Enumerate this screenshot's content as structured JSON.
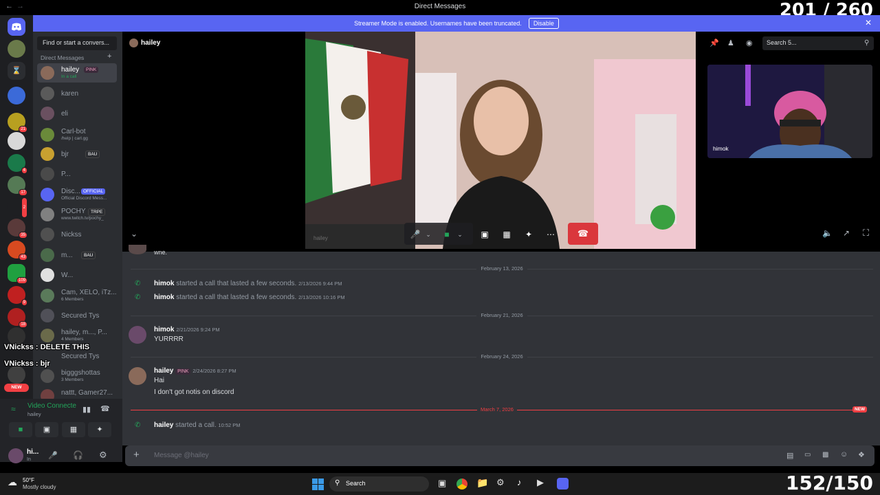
{
  "window": {
    "title": "Direct Messages"
  },
  "overlay": {
    "top_counter": "201 / 260",
    "bottom_counter": "152/150"
  },
  "banner": {
    "text": "Streamer Mode is enabled. Usernames have been truncated.",
    "button": "Disable"
  },
  "servers": {
    "badges": [
      "21",
      "4",
      "17",
      "2",
      "35",
      "43",
      "109",
      "9",
      "18",
      "NEW"
    ]
  },
  "dm_panel": {
    "search_placeholder": "Find or start a convers...",
    "section_label": "Direct Messages",
    "items": [
      {
        "name": "hailey",
        "tag": "PINK",
        "sub": "In a call"
      },
      {
        "name": "karen"
      },
      {
        "name": "eli"
      },
      {
        "name": "Carl-bot",
        "sub": "/help | carl.gg"
      },
      {
        "name": "bjr",
        "tag": "BAU"
      },
      {
        "name": "P..."
      },
      {
        "name": "Disc...",
        "tag": "OFFICIAL",
        "sub": "Official Discord Mess..."
      },
      {
        "name": "POCHY",
        "tag": "TRPE",
        "sub": "www.twitch.tv/pochy_"
      },
      {
        "name": "Nickss"
      },
      {
        "name": "m...",
        "tag": "BAU"
      },
      {
        "name": "W..."
      },
      {
        "name": "Cam, XELO, iTz...",
        "sub": "6 Members"
      },
      {
        "name": "Secured Tys"
      },
      {
        "name": "hailey, m..., P...",
        "sub": "4 Members"
      },
      {
        "name": "Secured Tys"
      },
      {
        "name": "bigggshottas",
        "sub": "3 Members"
      },
      {
        "name": "nattt, Gamer27..."
      }
    ]
  },
  "stream_chat": [
    {
      "text": "VNickss : DELETE THIS"
    },
    {
      "text": "VNickss : bjr"
    }
  ],
  "voice": {
    "title": "Video Connecte",
    "channel": "hailey"
  },
  "user": {
    "name": "hi...",
    "status": "In"
  },
  "call": {
    "header_name": "hailey",
    "search_placeholder": "Search 5...",
    "pip_name": "himok",
    "faint_name": "hailey"
  },
  "messages": {
    "partial_top": "wne.",
    "dividers": [
      "February 13, 2026",
      "February 21, 2026",
      "February 24, 2026",
      "March 7, 2026"
    ],
    "new_badge": "NEW",
    "call1": {
      "user": "himok",
      "text": "started a call that lasted a few seconds.",
      "ts": "2/13/2026 9:44 PM"
    },
    "call2": {
      "user": "himok",
      "text": "started a call that lasted a few seconds.",
      "ts": "2/13/2026 10:16 PM"
    },
    "msg1": {
      "user": "himok",
      "ts": "2/21/2026 9:24 PM",
      "lines": [
        "YURRRR"
      ]
    },
    "msg2": {
      "user": "hailey",
      "tag": "PINK",
      "ts": "2/24/2026 8:27 PM",
      "lines": [
        "Hai",
        "I don't got notis on discord"
      ]
    },
    "call3": {
      "user": "hailey",
      "text": "started a call.",
      "ts": "10:52 PM"
    }
  },
  "composer": {
    "placeholder": "Message @hailey"
  },
  "taskbar": {
    "weather_temp": "50°F",
    "weather_desc": "Mostly cloudy",
    "search": "Search"
  },
  "colors": {
    "accent": "#5865f2",
    "green": "#23a55a",
    "red": "#da373c",
    "new": "#f23f43"
  }
}
